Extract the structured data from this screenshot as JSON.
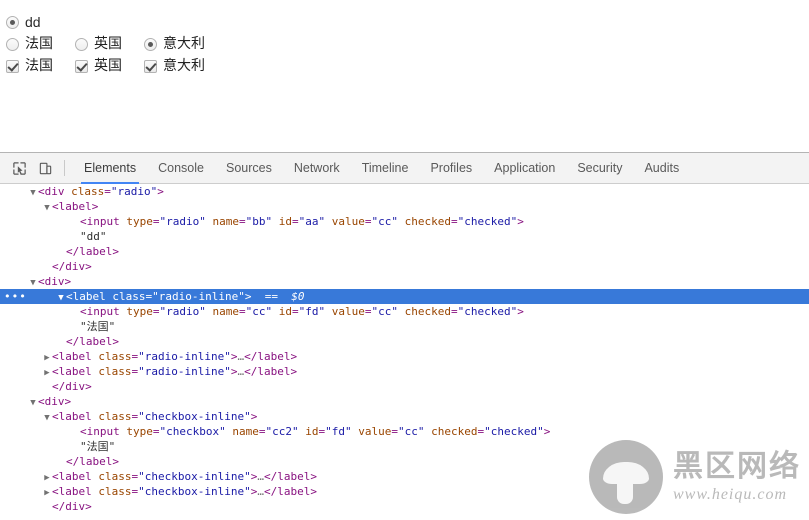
{
  "page": {
    "radio_single": {
      "label": "dd",
      "checked": true
    },
    "radio_inline": [
      {
        "label": "法国",
        "checked": false
      },
      {
        "label": "英国",
        "checked": false
      },
      {
        "label": "意大利",
        "checked": true
      }
    ],
    "checkbox_inline": [
      {
        "label": "法国",
        "checked": true
      },
      {
        "label": "英国",
        "checked": true
      },
      {
        "label": "意大利",
        "checked": true
      }
    ]
  },
  "devtools": {
    "icons": {
      "inspect": "inspect-element-icon",
      "device": "device-toolbar-icon"
    },
    "tabs": [
      {
        "label": "Elements",
        "active": true
      },
      {
        "label": "Console",
        "active": false
      },
      {
        "label": "Sources",
        "active": false
      },
      {
        "label": "Network",
        "active": false
      },
      {
        "label": "Timeline",
        "active": false
      },
      {
        "label": "Profiles",
        "active": false
      },
      {
        "label": "Application",
        "active": false
      },
      {
        "label": "Security",
        "active": false
      },
      {
        "label": "Audits",
        "active": false
      }
    ],
    "dom_lines": [
      {
        "indent": 1,
        "arrow": "down",
        "parts": [
          {
            "t": "punct",
            "s": "<"
          },
          {
            "t": "tag",
            "s": "div"
          },
          {
            "t": "attr",
            "s": " class"
          },
          {
            "t": "punct",
            "s": "="
          },
          {
            "t": "val",
            "s": "\"radio\""
          },
          {
            "t": "punct",
            "s": ">"
          }
        ]
      },
      {
        "indent": 2,
        "arrow": "down",
        "parts": [
          {
            "t": "punct",
            "s": "<"
          },
          {
            "t": "tag",
            "s": "label"
          },
          {
            "t": "punct",
            "s": ">"
          }
        ]
      },
      {
        "indent": 4,
        "arrow": "none",
        "parts": [
          {
            "t": "punct",
            "s": "<"
          },
          {
            "t": "tag",
            "s": "input"
          },
          {
            "t": "attr",
            "s": " type"
          },
          {
            "t": "punct",
            "s": "="
          },
          {
            "t": "val",
            "s": "\"radio\""
          },
          {
            "t": "attr",
            "s": " name"
          },
          {
            "t": "punct",
            "s": "="
          },
          {
            "t": "val",
            "s": "\"bb\""
          },
          {
            "t": "attr",
            "s": " id"
          },
          {
            "t": "punct",
            "s": "="
          },
          {
            "t": "val",
            "s": "\"aa\""
          },
          {
            "t": "attr",
            "s": " value"
          },
          {
            "t": "punct",
            "s": "="
          },
          {
            "t": "val",
            "s": "\"cc\""
          },
          {
            "t": "attr",
            "s": " checked"
          },
          {
            "t": "punct",
            "s": "="
          },
          {
            "t": "val",
            "s": "\"checked\""
          },
          {
            "t": "punct",
            "s": ">"
          }
        ]
      },
      {
        "indent": 4,
        "arrow": "none",
        "parts": [
          {
            "t": "txt",
            "s": "\"dd\""
          }
        ]
      },
      {
        "indent": 3,
        "arrow": "none",
        "parts": [
          {
            "t": "punct",
            "s": "</"
          },
          {
            "t": "tag",
            "s": "label"
          },
          {
            "t": "punct",
            "s": ">"
          }
        ]
      },
      {
        "indent": 2,
        "arrow": "none",
        "parts": [
          {
            "t": "punct",
            "s": "</"
          },
          {
            "t": "tag",
            "s": "div"
          },
          {
            "t": "punct",
            "s": ">"
          }
        ]
      },
      {
        "indent": 1,
        "arrow": "down",
        "parts": [
          {
            "t": "punct",
            "s": "<"
          },
          {
            "t": "tag",
            "s": "div"
          },
          {
            "t": "punct",
            "s": ">"
          }
        ]
      },
      {
        "indent": 3,
        "arrow": "down",
        "selected": true,
        "dots": "•••",
        "parts": [
          {
            "t": "punct",
            "s": "<"
          },
          {
            "t": "tag",
            "s": "label"
          },
          {
            "t": "attr",
            "s": " class"
          },
          {
            "t": "punct",
            "s": "="
          },
          {
            "t": "val",
            "s": "\"radio-inline\""
          },
          {
            "t": "punct",
            "s": ">"
          },
          {
            "t": "dollar",
            "s": "  ==  $0"
          }
        ]
      },
      {
        "indent": 4,
        "arrow": "none",
        "parts": [
          {
            "t": "punct",
            "s": "<"
          },
          {
            "t": "tag",
            "s": "input"
          },
          {
            "t": "attr",
            "s": " type"
          },
          {
            "t": "punct",
            "s": "="
          },
          {
            "t": "val",
            "s": "\"radio\""
          },
          {
            "t": "attr",
            "s": " name"
          },
          {
            "t": "punct",
            "s": "="
          },
          {
            "t": "val",
            "s": "\"cc\""
          },
          {
            "t": "attr",
            "s": " id"
          },
          {
            "t": "punct",
            "s": "="
          },
          {
            "t": "val",
            "s": "\"fd\""
          },
          {
            "t": "attr",
            "s": " value"
          },
          {
            "t": "punct",
            "s": "="
          },
          {
            "t": "val",
            "s": "\"cc\""
          },
          {
            "t": "attr",
            "s": " checked"
          },
          {
            "t": "punct",
            "s": "="
          },
          {
            "t": "val",
            "s": "\"checked\""
          },
          {
            "t": "punct",
            "s": ">"
          }
        ]
      },
      {
        "indent": 4,
        "arrow": "none",
        "parts": [
          {
            "t": "txt",
            "s": "\"法国\""
          }
        ]
      },
      {
        "indent": 3,
        "arrow": "none",
        "parts": [
          {
            "t": "punct",
            "s": "</"
          },
          {
            "t": "tag",
            "s": "label"
          },
          {
            "t": "punct",
            "s": ">"
          }
        ]
      },
      {
        "indent": 2,
        "arrow": "right",
        "parts": [
          {
            "t": "punct",
            "s": "<"
          },
          {
            "t": "tag",
            "s": "label"
          },
          {
            "t": "attr",
            "s": " class"
          },
          {
            "t": "punct",
            "s": "="
          },
          {
            "t": "val",
            "s": "\"radio-inline\""
          },
          {
            "t": "punct",
            "s": ">"
          },
          {
            "t": "ellip",
            "s": "…"
          },
          {
            "t": "punct",
            "s": "</"
          },
          {
            "t": "tag",
            "s": "label"
          },
          {
            "t": "punct",
            "s": ">"
          }
        ]
      },
      {
        "indent": 2,
        "arrow": "right",
        "parts": [
          {
            "t": "punct",
            "s": "<"
          },
          {
            "t": "tag",
            "s": "label"
          },
          {
            "t": "attr",
            "s": " class"
          },
          {
            "t": "punct",
            "s": "="
          },
          {
            "t": "val",
            "s": "\"radio-inline\""
          },
          {
            "t": "punct",
            "s": ">"
          },
          {
            "t": "ellip",
            "s": "…"
          },
          {
            "t": "punct",
            "s": "</"
          },
          {
            "t": "tag",
            "s": "label"
          },
          {
            "t": "punct",
            "s": ">"
          }
        ]
      },
      {
        "indent": 2,
        "arrow": "none",
        "parts": [
          {
            "t": "punct",
            "s": "</"
          },
          {
            "t": "tag",
            "s": "div"
          },
          {
            "t": "punct",
            "s": ">"
          }
        ]
      },
      {
        "indent": 1,
        "arrow": "down",
        "parts": [
          {
            "t": "punct",
            "s": "<"
          },
          {
            "t": "tag",
            "s": "div"
          },
          {
            "t": "punct",
            "s": ">"
          }
        ]
      },
      {
        "indent": 2,
        "arrow": "down",
        "parts": [
          {
            "t": "punct",
            "s": "<"
          },
          {
            "t": "tag",
            "s": "label"
          },
          {
            "t": "attr",
            "s": " class"
          },
          {
            "t": "punct",
            "s": "="
          },
          {
            "t": "val",
            "s": "\"checkbox-inline\""
          },
          {
            "t": "punct",
            "s": ">"
          }
        ]
      },
      {
        "indent": 4,
        "arrow": "none",
        "parts": [
          {
            "t": "punct",
            "s": "<"
          },
          {
            "t": "tag",
            "s": "input"
          },
          {
            "t": "attr",
            "s": " type"
          },
          {
            "t": "punct",
            "s": "="
          },
          {
            "t": "val",
            "s": "\"checkbox\""
          },
          {
            "t": "attr",
            "s": " name"
          },
          {
            "t": "punct",
            "s": "="
          },
          {
            "t": "val",
            "s": "\"cc2\""
          },
          {
            "t": "attr",
            "s": " id"
          },
          {
            "t": "punct",
            "s": "="
          },
          {
            "t": "val",
            "s": "\"fd\""
          },
          {
            "t": "attr",
            "s": " value"
          },
          {
            "t": "punct",
            "s": "="
          },
          {
            "t": "val",
            "s": "\"cc\""
          },
          {
            "t": "attr",
            "s": " checked"
          },
          {
            "t": "punct",
            "s": "="
          },
          {
            "t": "val",
            "s": "\"checked\""
          },
          {
            "t": "punct",
            "s": ">"
          }
        ]
      },
      {
        "indent": 4,
        "arrow": "none",
        "parts": [
          {
            "t": "txt",
            "s": "\"法国\""
          }
        ]
      },
      {
        "indent": 3,
        "arrow": "none",
        "parts": [
          {
            "t": "punct",
            "s": "</"
          },
          {
            "t": "tag",
            "s": "label"
          },
          {
            "t": "punct",
            "s": ">"
          }
        ]
      },
      {
        "indent": 2,
        "arrow": "right",
        "parts": [
          {
            "t": "punct",
            "s": "<"
          },
          {
            "t": "tag",
            "s": "label"
          },
          {
            "t": "attr",
            "s": " class"
          },
          {
            "t": "punct",
            "s": "="
          },
          {
            "t": "val",
            "s": "\"checkbox-inline\""
          },
          {
            "t": "punct",
            "s": ">"
          },
          {
            "t": "ellip",
            "s": "…"
          },
          {
            "t": "punct",
            "s": "</"
          },
          {
            "t": "tag",
            "s": "label"
          },
          {
            "t": "punct",
            "s": ">"
          }
        ]
      },
      {
        "indent": 2,
        "arrow": "right",
        "parts": [
          {
            "t": "punct",
            "s": "<"
          },
          {
            "t": "tag",
            "s": "label"
          },
          {
            "t": "attr",
            "s": " class"
          },
          {
            "t": "punct",
            "s": "="
          },
          {
            "t": "val",
            "s": "\"checkbox-inline\""
          },
          {
            "t": "punct",
            "s": ">"
          },
          {
            "t": "ellip",
            "s": "…"
          },
          {
            "t": "punct",
            "s": "</"
          },
          {
            "t": "tag",
            "s": "label"
          },
          {
            "t": "punct",
            "s": ">"
          }
        ]
      },
      {
        "indent": 2,
        "arrow": "none",
        "parts": [
          {
            "t": "punct",
            "s": "</"
          },
          {
            "t": "tag",
            "s": "div"
          },
          {
            "t": "punct",
            "s": ">"
          }
        ]
      }
    ]
  },
  "watermark": {
    "cn": "黑区网络",
    "url": "www.heiqu.com"
  },
  "colors": {
    "selection_blue": "#3879d9",
    "tab_underline": "#4285f4",
    "tag": "#881280",
    "attr": "#994500",
    "value": "#1a1aa6"
  }
}
